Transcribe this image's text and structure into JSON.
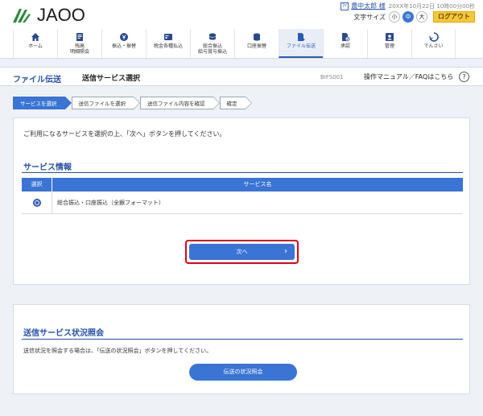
{
  "header": {
    "logo_text": "JAOO",
    "user_icon": "ﾏｲ",
    "user_name": "農中太郎 様",
    "timestamp": "20XX年10月22日 10時00分00秒",
    "font_size_label": "文字サイズ",
    "font_sizes": [
      "小",
      "中",
      "大"
    ],
    "logout_label": "ログアウト"
  },
  "nav": {
    "items": [
      {
        "label": "ホーム",
        "icon": "home-icon"
      },
      {
        "label": "残高\n明細照会",
        "icon": "document-icon"
      },
      {
        "label": "振込・振替",
        "icon": "yen-coin-icon"
      },
      {
        "label": "税金各種払込",
        "icon": "card-icon"
      },
      {
        "label": "総合振込\n給与賞与振込",
        "icon": "coins-icon"
      },
      {
        "label": "口座振替",
        "icon": "stack-icon"
      },
      {
        "label": "ファイル伝送",
        "icon": "file-transfer-icon"
      },
      {
        "label": "承認",
        "icon": "approve-icon"
      },
      {
        "label": "管理",
        "icon": "admin-icon"
      },
      {
        "label": "でんさい",
        "icon": "denshi-icon"
      }
    ]
  },
  "title_bar": {
    "main": "ファイル伝送",
    "sub": "送信サービス選択",
    "screen_id": "BIFS001",
    "manual_link": "操作マニュアル／FAQはこちら",
    "help_icon": "?"
  },
  "steps": [
    "サービスを選択",
    "送信ファイルを選択",
    "送信ファイル内容を確認",
    "確定"
  ],
  "panel1": {
    "message": "ご利用になるサービスを選択の上、「次へ」ボタンを押してください。",
    "section_title": "サービス情報",
    "table_headers": [
      "選択",
      "サービス名"
    ],
    "rows": [
      {
        "name": "総合振込・口座振込（全銀フォーマット）"
      }
    ],
    "next_label": "次へ",
    "next_arrow": "›"
  },
  "panel2": {
    "section_title": "送信サービス状況照会",
    "message": "送信状況を照会する場合は、「伝送の状況照会」ボタンを押してください。",
    "button_label": "伝送の状況照会"
  },
  "colors": {
    "accent": "#3a74d4",
    "title_blue": "#2550a8",
    "logout_yellow": "#f4c838",
    "highlight_red": "#e0001a"
  }
}
